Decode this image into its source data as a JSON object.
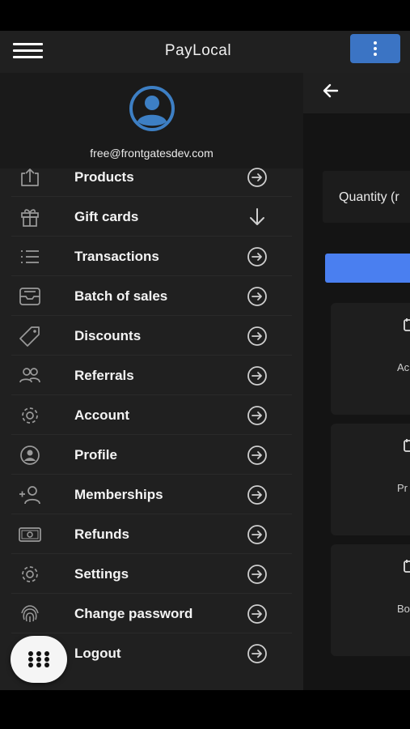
{
  "app": {
    "title": "PayLocal"
  },
  "drawer": {
    "email": "free@frontgatesdev.com",
    "items": [
      {
        "label": "Products",
        "icon": "upload-tray-icon",
        "arrow": "arrow-right-circle-icon"
      },
      {
        "label": "Gift cards",
        "icon": "gift-icon",
        "arrow": "arrow-down-icon"
      },
      {
        "label": "Transactions",
        "icon": "list-icon",
        "arrow": "arrow-right-circle-icon"
      },
      {
        "label": "Batch of sales",
        "icon": "inbox-tray-icon",
        "arrow": "arrow-right-circle-icon"
      },
      {
        "label": "Discounts",
        "icon": "tag-icon",
        "arrow": "arrow-right-circle-icon"
      },
      {
        "label": "Referrals",
        "icon": "people-icon",
        "arrow": "arrow-right-circle-icon"
      },
      {
        "label": "Account",
        "icon": "gear-icon",
        "arrow": "arrow-right-circle-icon"
      },
      {
        "label": "Profile",
        "icon": "person-circle-icon",
        "arrow": "arrow-right-circle-icon"
      },
      {
        "label": "Memberships",
        "icon": "person-add-icon",
        "arrow": "arrow-right-circle-icon"
      },
      {
        "label": "Refunds",
        "icon": "cash-icon",
        "arrow": "arrow-right-circle-icon"
      },
      {
        "label": "Settings",
        "icon": "gear-icon",
        "arrow": "arrow-right-circle-icon"
      },
      {
        "label": "Change password",
        "icon": "fingerprint-icon",
        "arrow": "arrow-right-circle-icon"
      },
      {
        "label": "Logout",
        "icon": "logout-icon",
        "arrow": "arrow-right-circle-icon"
      }
    ]
  },
  "background": {
    "quantity_label": "Quantity (r",
    "cards": [
      {
        "text": "Ac"
      },
      {
        "text": "Pr"
      },
      {
        "text": "Bo"
      }
    ]
  },
  "colors": {
    "accent": "#3b74c4",
    "primary_button": "#4a7ff0",
    "avatar": "#3d7fc4"
  }
}
